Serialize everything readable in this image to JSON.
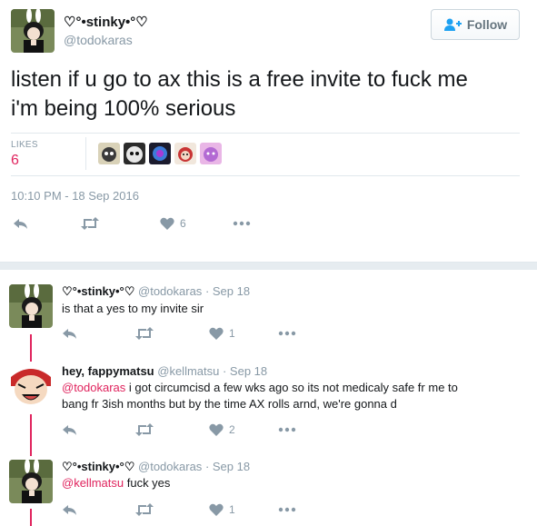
{
  "colors": {
    "accent": "#e0245e",
    "muted": "#8899a6",
    "text": "#14171a",
    "border": "#e1e8ed"
  },
  "main_tweet": {
    "display_name": "♡°•stinky•°♡",
    "handle": "@todokaras",
    "follow_label": "Follow",
    "text_line1": "listen if u go to ax this is a free invite to fuck me",
    "text_line2": "i'm being 100% serious",
    "likes_label": "LIKES",
    "likes_count": "6",
    "timestamp": "10:10 PM - 18 Sep 2016",
    "like_action_count": "6"
  },
  "replies": [
    {
      "display_name": "♡°•stinky•°♡",
      "handle": "@todokaras",
      "date": "· Sep 18",
      "text": "is that a yes to my invite sir",
      "like_count": "1"
    },
    {
      "display_name": "hey, fappymatsu",
      "handle": "@kellmatsu",
      "date": "· Sep 18",
      "mention": "@todokaras",
      "text_line1": " i got circumcisd a few wks ago so its not medicaly safe fr me to",
      "text_line2": "bang fr 3ish months but by the time AX rolls arnd, we're gonna d",
      "like_count": "2"
    },
    {
      "display_name": "♡°•stinky•°♡",
      "handle": "@todokaras",
      "date": "· Sep 18",
      "mention": "@kellmatsu",
      "text": " fuck yes",
      "like_count": "1"
    }
  ],
  "icons": [
    "follow-person-icon",
    "reply-icon",
    "retweet-icon",
    "heart-icon",
    "more-icon"
  ]
}
